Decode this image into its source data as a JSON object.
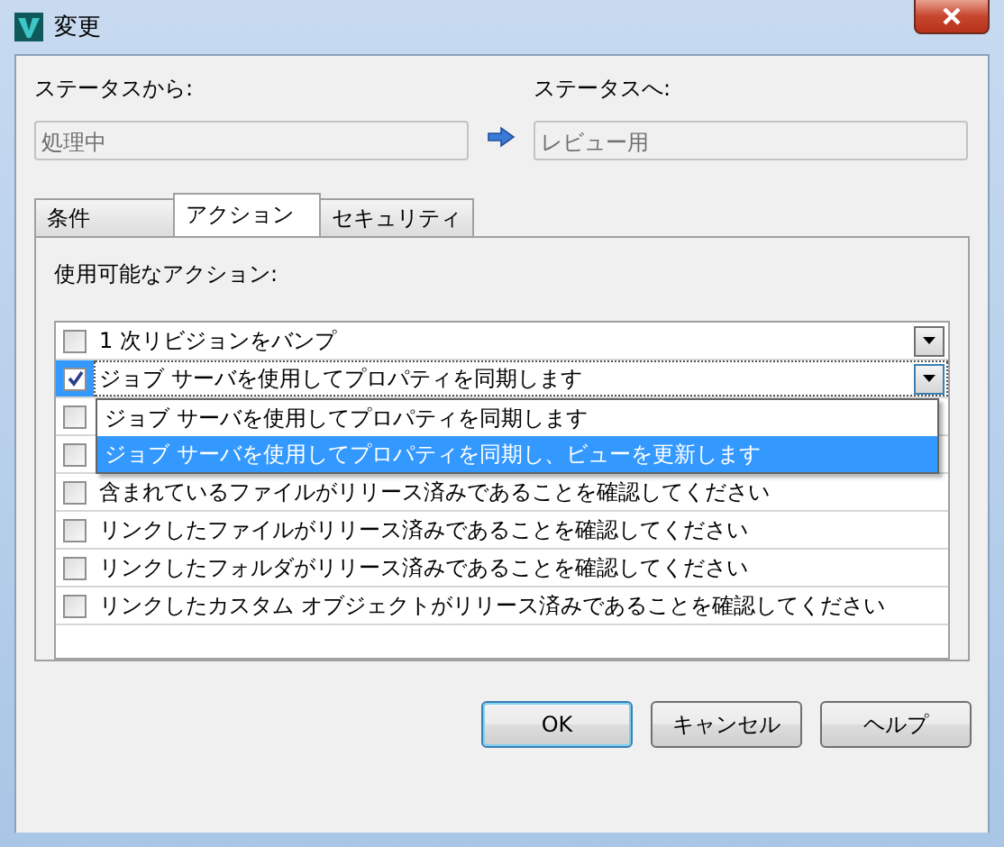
{
  "window": {
    "title": "変更"
  },
  "from_status": {
    "label": "ステータスから:",
    "value": "処理中"
  },
  "to_status": {
    "label": "ステータスへ:",
    "value": "レビュー用"
  },
  "tabs": [
    {
      "label": "条件",
      "selected": false
    },
    {
      "label": "アクション",
      "selected": true
    },
    {
      "label": "セキュリティ",
      "selected": false
    }
  ],
  "actions_label": "使用可能なアクション:",
  "actions": [
    {
      "kind": "dropdown",
      "checked": false,
      "selected": false,
      "label": "1 次リビジョンをバンプ"
    },
    {
      "kind": "dropdown",
      "checked": true,
      "selected": true,
      "label": "ジョブ サーバを使用してプロパティを同期します",
      "expanded": true,
      "options": [
        {
          "label": "ジョブ サーバを使用してプロパティを同期します",
          "selected": false
        },
        {
          "label": "ジョブ サーバを使用してプロパティを同期し、ビューを更新します",
          "selected": true
        }
      ]
    },
    {
      "kind": "plain",
      "checked": false,
      "selected": false
    },
    {
      "kind": "plain",
      "checked": false,
      "selected": false
    },
    {
      "kind": "plain",
      "checked": false,
      "selected": false,
      "label": "含まれているファイルがリリース済みであることを確認してください"
    },
    {
      "kind": "plain",
      "checked": false,
      "selected": false,
      "label": "リンクしたファイルがリリース済みであることを確認してください"
    },
    {
      "kind": "plain",
      "checked": false,
      "selected": false,
      "label": "リンクしたフォルダがリリース済みであることを確認してください"
    },
    {
      "kind": "plain",
      "checked": false,
      "selected": false,
      "label": "リンクしたカスタム オブジェクトがリリース済みであることを確認してください"
    }
  ],
  "buttons": [
    {
      "label": "OK",
      "default": true
    },
    {
      "label": "キャンセル",
      "default": false
    },
    {
      "label": "ヘルプ",
      "default": false
    }
  ]
}
